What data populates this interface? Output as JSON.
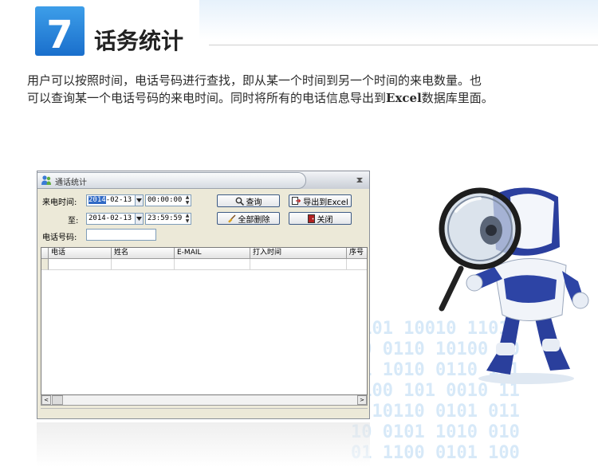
{
  "header": {
    "number": "7",
    "title": "话务统计"
  },
  "description": {
    "line1": "用户可以按照时间，电话号码进行查找，即从某一个时间到另一个时间的来电数量。也",
    "line2_before": "可以查询某一个电话号码的来电时间。同时将所有的电话信息导出到",
    "line2_bold": "Excel",
    "line2_after": "数据库里面。"
  },
  "window": {
    "title": "通话统计",
    "form": {
      "from_label": "来电时间:",
      "from_date_selected": "2014",
      "from_date_rest": "-02-13",
      "from_time": "00:00:00",
      "to_label": "至:",
      "to_date": "2014-02-13",
      "to_time": "23:59:59",
      "phone_label": "电话号码:",
      "phone_value": ""
    },
    "buttons": {
      "query": "查询",
      "export": "导出到Excel",
      "delete_all": "全部删除",
      "close": "关闭"
    },
    "grid": {
      "columns": [
        "电话",
        "姓名",
        "E-MAIL",
        "打入时间",
        "序号"
      ]
    },
    "scroll": {
      "left": "<",
      "right": ">"
    }
  },
  "background_digits": [
    "0101 10010 1101",
    "10 0110 10100 10",
    "01 1010 0110 101",
    "1100 101 0010 11",
    "0 10110 0101 011",
    "10 0101 1010 010",
    "01 1100 0101 100"
  ]
}
